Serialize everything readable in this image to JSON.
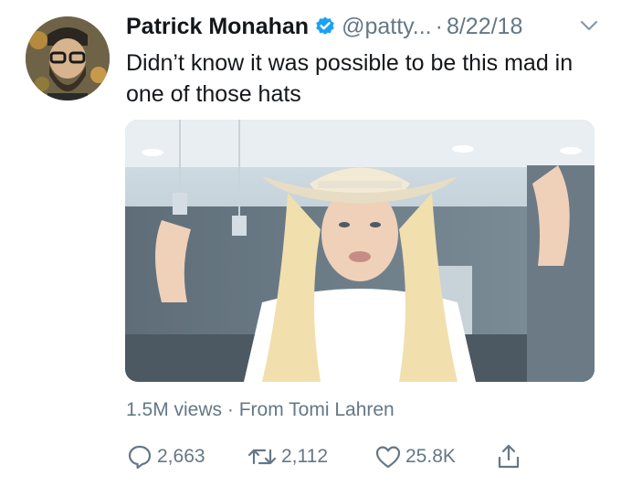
{
  "tweet": {
    "author": {
      "name": "Patrick Monahan",
      "handle": "@patty...",
      "verified": true
    },
    "separator": "·",
    "date": "8/22/18",
    "text": "Didn’t know it was possible to be this mad in one of those hats",
    "media_meta": {
      "views": "1.5M views",
      "separator": "·",
      "source": "From Tomi Lahren"
    },
    "actions": {
      "replies": "2,663",
      "retweets": "2,112",
      "likes": "25.8K"
    }
  },
  "colors": {
    "text_primary": "#14171a",
    "text_secondary": "#657786",
    "verified_blue": "#1da1f2"
  },
  "icons": [
    "verified-badge-icon",
    "chevron-down-icon",
    "reply-icon",
    "retweet-icon",
    "like-icon",
    "share-icon"
  ]
}
